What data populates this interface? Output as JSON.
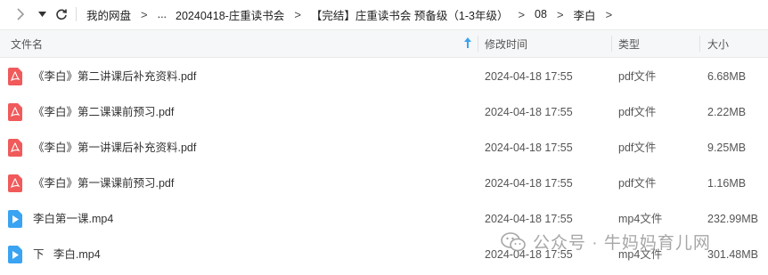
{
  "nav": {
    "breadcrumbs": [
      "我的网盘",
      "...",
      "20240418-庄重读书会",
      "【完结】庄重读书会 预备级（1-3年级）",
      "08",
      "李白"
    ]
  },
  "columns": {
    "name": "文件名",
    "modified": "修改时间",
    "type": "类型",
    "size": "大小"
  },
  "files": [
    {
      "icon": "pdf-icon",
      "name": "《李白》第二讲课后补充资料.pdf",
      "modified": "2024-04-18 17:55",
      "type": "pdf文件",
      "size": "6.68MB"
    },
    {
      "icon": "pdf-icon",
      "name": "《李白》第二课课前预习.pdf",
      "modified": "2024-04-18 17:55",
      "type": "pdf文件",
      "size": "2.22MB"
    },
    {
      "icon": "pdf-icon",
      "name": "《李白》第一讲课后补充资料.pdf",
      "modified": "2024-04-18 17:55",
      "type": "pdf文件",
      "size": "9.25MB"
    },
    {
      "icon": "pdf-icon",
      "name": "《李白》第一课课前预习.pdf",
      "modified": "2024-04-18 17:55",
      "type": "pdf文件",
      "size": "1.16MB"
    },
    {
      "icon": "video-icon",
      "name": "李白第一课.mp4",
      "modified": "2024-04-18 17:55",
      "type": "mp4文件",
      "size": "232.99MB"
    },
    {
      "icon": "video-icon",
      "name": "下   李白.mp4",
      "modified": "2024-04-18 17:55",
      "type": "mp4文件",
      "size": "301.48MB"
    }
  ],
  "watermark": {
    "text": "公众号 · 牛妈妈育儿网"
  },
  "colors": {
    "pdf_icon": "#f05a5b",
    "video_icon": "#3aa3f2",
    "sort_arrow": "#3aa3f2"
  }
}
